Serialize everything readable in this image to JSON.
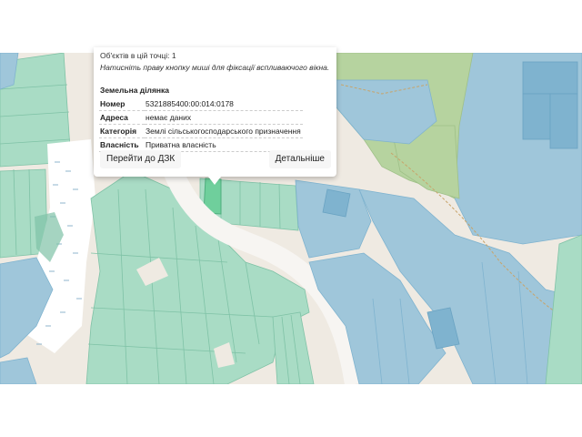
{
  "popup": {
    "objects_text": "Об'єктів в цій точці: 1",
    "hint": "Натисніть праву кнопку миші для фіксації вспливаючого вікна.",
    "section_title": "Земельна ділянка",
    "rows": [
      {
        "label": "Номер",
        "value": "5321885400:00:014:0178"
      },
      {
        "label": "Адреса",
        "value": "немає даних"
      },
      {
        "label": "Категорія",
        "value": "Землі сільськогосподарського призначення"
      },
      {
        "label": "Власність",
        "value": "Приватна власність"
      }
    ],
    "buttons": {
      "dzk": "Перейти до ДЗК",
      "details": "Детальніше"
    }
  },
  "colors": {
    "base": "#efeae2",
    "parcel_green": "#a9dcc5",
    "parcel_blue": "#9fc6da",
    "parcel_blue_dark": "#7fb3cf",
    "forest": "#b6d39f",
    "wetland": "#ffffff",
    "road": "#f7f5f2",
    "selected": "#6fcf9c"
  }
}
